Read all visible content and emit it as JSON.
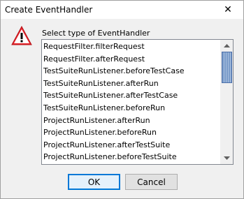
{
  "window": {
    "title": "Create EventHandler",
    "close_glyph": "✕"
  },
  "icon": "warning-triangle-icon",
  "prompt": "Select type of EventHandler",
  "list": {
    "items": [
      "RequestFilter.filterRequest",
      "RequestFilter.afterRequest",
      "TestSuiteRunListener.beforeTestCase",
      "TestSuiteRunListener.afterRun",
      "TestSuiteRunListener.afterTestCase",
      "TestSuiteRunListener.beforeRun",
      "ProjectRunListener.afterRun",
      "ProjectRunListener.beforeRun",
      "ProjectRunListener.afterTestSuite",
      "ProjectRunListener.beforeTestSuite"
    ]
  },
  "buttons": {
    "ok": "OK",
    "cancel": "Cancel"
  }
}
